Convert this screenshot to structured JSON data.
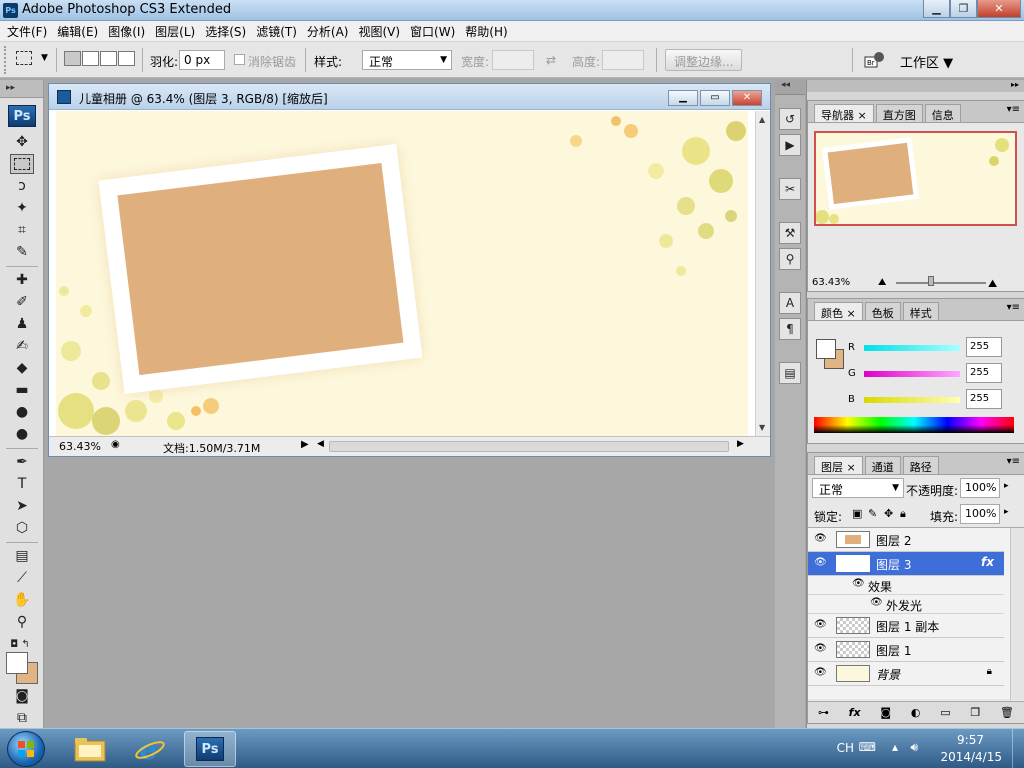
{
  "window": {
    "title": "Adobe Photoshop CS3 Extended",
    "icon_label": "Ps",
    "controls": [
      "minimize",
      "maximize",
      "close"
    ]
  },
  "menu": [
    "文件(F)",
    "编辑(E)",
    "图像(I)",
    "图层(L)",
    "选择(S)",
    "滤镜(T)",
    "分析(A)",
    "视图(V)",
    "窗口(W)",
    "帮助(H)"
  ],
  "options": {
    "feather_label": "羽化:",
    "feather_value": "0 px",
    "antialias_label": "消除锯齿",
    "style_label": "样式:",
    "style_value": "正常",
    "width_label": "宽度:",
    "height_label": "高度:",
    "refine_edge": "调整边缘...",
    "workspace": "工作区"
  },
  "toolbox": {
    "logo": "Ps"
  },
  "document": {
    "title": "儿童相册 @ 63.4% (图层 3, RGB/8) [缩放后]",
    "zoom": "63.43%",
    "doc_info": "文档:1.50M/3.71M",
    "photo_frame_fill": "#dfb07e",
    "background_color": "#fdf8dc"
  },
  "navigator": {
    "tabs": [
      "导航器",
      "直方图",
      "信息"
    ],
    "zoom": "63.43%"
  },
  "color_panel": {
    "tabs": [
      "颜色",
      "色板",
      "样式"
    ],
    "channels": [
      {
        "label": "R",
        "value": "255",
        "color": "#00c0c8"
      },
      {
        "label": "G",
        "value": "255",
        "color": "#e000c8"
      },
      {
        "label": "B",
        "value": "255",
        "color": "#d8d800"
      }
    ],
    "foreground": "#ffffff",
    "background": "#e0b483"
  },
  "layers_panel": {
    "tabs": [
      "图层",
      "通道",
      "路径"
    ],
    "blend_mode": "正常",
    "opacity_label": "不透明度:",
    "opacity": "100%",
    "lock_label": "锁定:",
    "fill_label": "填充:",
    "fill": "100%",
    "layers": [
      {
        "name": "图层 2",
        "selected": false
      },
      {
        "name": "图层 3",
        "selected": true,
        "fx": "fx"
      },
      {
        "name": "图层 1 副本",
        "selected": false
      },
      {
        "name": "图层 1",
        "selected": false
      },
      {
        "name": "背景",
        "selected": false
      }
    ],
    "effects_label": "效果",
    "outer_glow_label": "外发光"
  },
  "taskbar": {
    "ime": "CH",
    "time": "9:57",
    "date": "2014/4/15",
    "ps_label": "Ps"
  }
}
